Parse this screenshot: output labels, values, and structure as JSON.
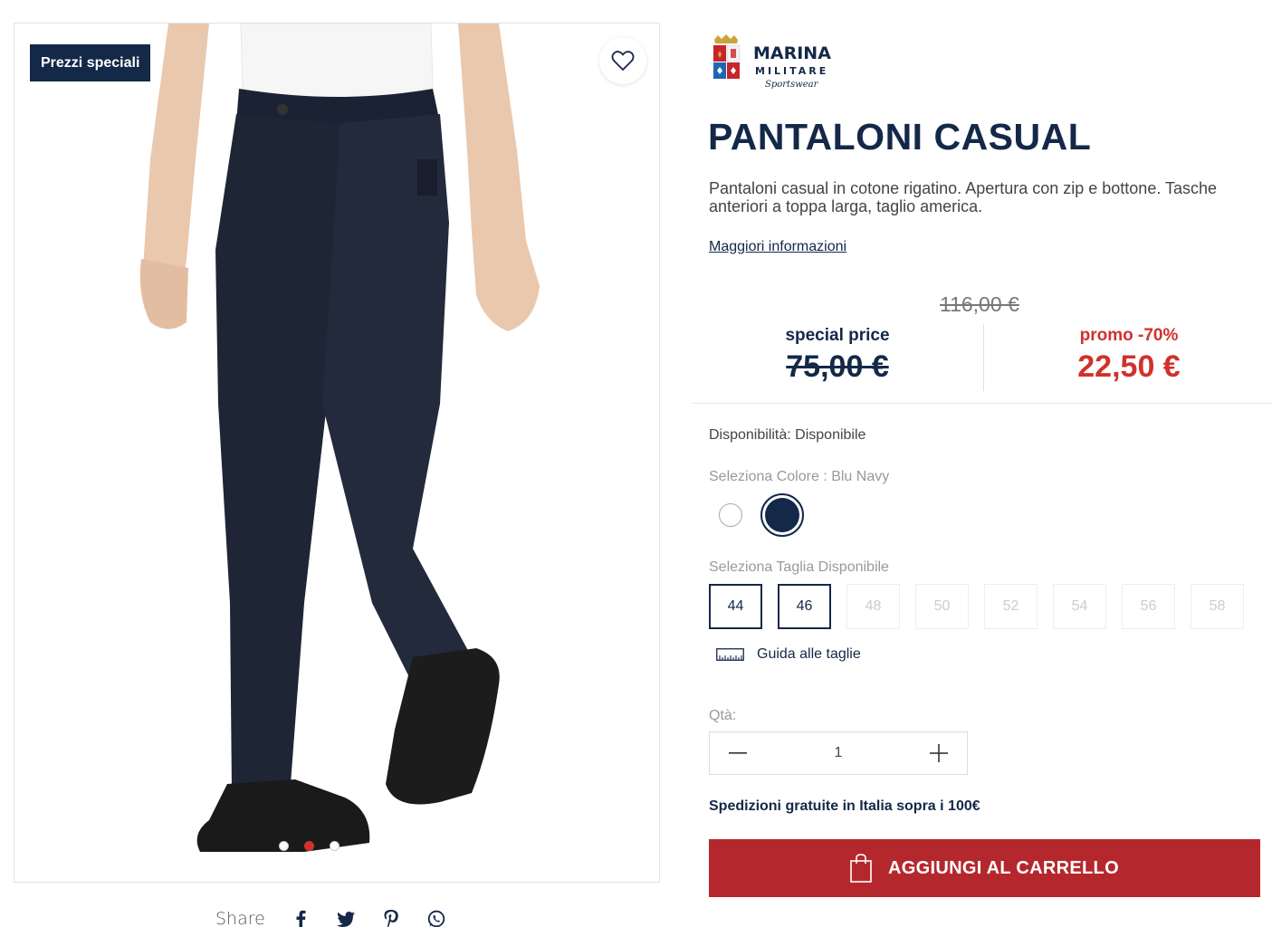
{
  "gallery": {
    "badge": "Prezzi speciali",
    "dots": 3,
    "active_dot": 1
  },
  "share": {
    "label": "Share",
    "icons": [
      "facebook-icon",
      "twitter-icon",
      "pinterest-icon",
      "whatsapp-icon"
    ]
  },
  "brand": {
    "name_line1": "MARINA",
    "name_line2": "MILITARE",
    "name_line3": "Sportswear"
  },
  "product": {
    "title": "PANTALONI CASUAL",
    "description": "Pantaloni casual in cotone rigatino. Apertura con zip e bottone. Tasche anteriori a toppa larga, taglio america.",
    "more_info": "Maggiori informazioni"
  },
  "pricing": {
    "original": "116,00 €",
    "special_label": "special price",
    "special_value": "75,00 €",
    "promo_label": "promo -70%",
    "promo_value": "22,50 €"
  },
  "availability": "Disponibilità: Disponibile",
  "colors": {
    "label": "Seleziona Colore : Blu Navy",
    "options": [
      "white",
      "navy"
    ],
    "selected": "navy",
    "navy_hex": "#142848"
  },
  "sizes": {
    "label": "Seleziona Taglia Disponibile",
    "options": [
      {
        "label": "44",
        "available": true
      },
      {
        "label": "46",
        "available": true
      },
      {
        "label": "48",
        "available": false
      },
      {
        "label": "50",
        "available": false
      },
      {
        "label": "52",
        "available": false
      },
      {
        "label": "54",
        "available": false
      },
      {
        "label": "56",
        "available": false
      },
      {
        "label": "58",
        "available": false
      }
    ],
    "guide": "Guida alle taglie"
  },
  "quantity": {
    "label": "Qtà:",
    "value": "1"
  },
  "shipping": "Spedizioni gratuite in Italia sopra i 100€",
  "cart_button": "AGGIUNGI AL CARRELLO",
  "theme": {
    "navy": "#142848",
    "red": "#d0312d",
    "cart_red": "#b4282d"
  }
}
